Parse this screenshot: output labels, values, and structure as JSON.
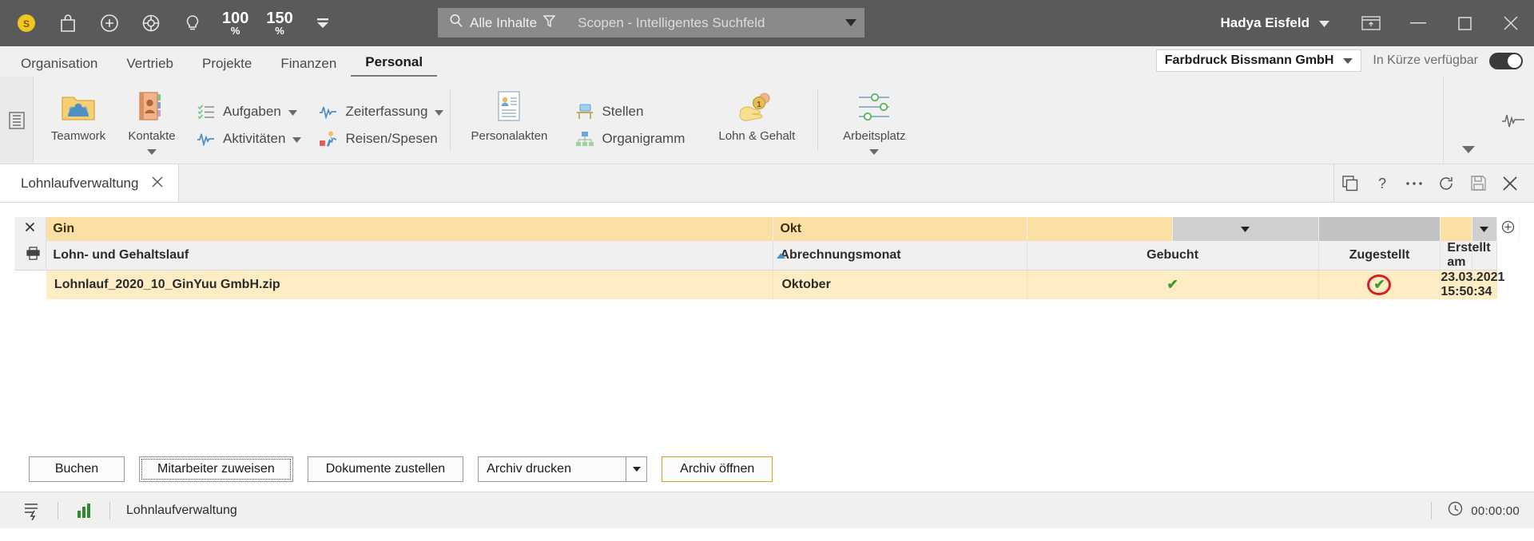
{
  "titlebar": {
    "quick_access": [
      {
        "name": "app-logo-icon",
        "label": "Scopevisio"
      },
      {
        "name": "shopping-bag-icon",
        "label": "Shop"
      },
      {
        "name": "plus-circle-icon",
        "label": "Neu"
      },
      {
        "name": "lifebuoy-icon",
        "label": "Hilfe"
      },
      {
        "name": "lightbulb-icon",
        "label": "Ideen"
      }
    ],
    "zoom_100": "100",
    "zoom_100_pct": "%",
    "zoom_150": "150",
    "zoom_150_pct": "%",
    "overflow_caret": "▼",
    "search_scope": "Alle Inhalte",
    "search_placeholder": "Scopen - Intelligentes Suchfeld",
    "search_value": "",
    "user": "Hadya Eisfeld",
    "window_buttons": {
      "restore_down": "🗗",
      "minimize": "—",
      "maximize": "□",
      "close": "✕"
    }
  },
  "ribbon": {
    "tabs": [
      {
        "label": "Organisation",
        "active": false
      },
      {
        "label": "Vertrieb",
        "active": false
      },
      {
        "label": "Projekte",
        "active": false
      },
      {
        "label": "Finanzen",
        "active": false
      },
      {
        "label": "Personal",
        "active": true
      }
    ],
    "company": "Farbdruck Bissmann GmbH",
    "availability_label": "In Kürze verfügbar",
    "availability_on": true,
    "big_buttons": [
      {
        "label": "Teamwork",
        "icon": "teamwork-folder-icon",
        "has_caret": false
      },
      {
        "label": "Kontakte",
        "icon": "contacts-book-icon",
        "has_caret": true
      },
      {
        "label": "Personalakten",
        "icon": "personnel-file-icon",
        "has_caret": false
      },
      {
        "label": "Lohn & Gehalt",
        "icon": "payroll-hand-coin-icon",
        "has_caret": false
      },
      {
        "label": "Arbeitsplatz",
        "icon": "workplace-sliders-icon",
        "has_caret": true
      }
    ],
    "small_buttons": [
      {
        "label": "Aufgaben",
        "icon": "tasks-checklist-icon",
        "has_caret": true
      },
      {
        "label": "Aktivitäten",
        "icon": "activities-pulse-icon",
        "has_caret": true
      },
      {
        "label": "Zeiterfassung",
        "icon": "time-tracking-pulse-icon",
        "has_caret": true
      },
      {
        "label": "Reisen/Spesen",
        "icon": "travel-expenses-icon",
        "has_caret": false
      },
      {
        "label": "Stellen",
        "icon": "jobs-desk-icon",
        "has_caret": false
      },
      {
        "label": "Organigramm",
        "icon": "org-chart-icon",
        "has_caret": false
      }
    ]
  },
  "doctabs": {
    "active_tab": "Lohnlaufverwaltung",
    "close_glyph": "✕",
    "tools": [
      {
        "name": "duplicate-window-icon"
      },
      {
        "name": "help-question-icon"
      },
      {
        "name": "more-options-icon"
      },
      {
        "name": "refresh-icon"
      },
      {
        "name": "save-icon"
      },
      {
        "name": "close-icon"
      }
    ]
  },
  "grid": {
    "filter_row": {
      "clear_glyph": "✕",
      "name_filter": "Gin",
      "month_filter": "Okt",
      "gebucht_filter": "",
      "zugestellt_filter": "",
      "erstellt_filter": "",
      "dropdown_glyph": "▼",
      "add_column_glyph": "⊕"
    },
    "columns": [
      {
        "key": "name",
        "label": "Lohn- und Gehaltslauf",
        "sorted": true,
        "sort_dir": "▲",
        "align": "left"
      },
      {
        "key": "month",
        "label": "Abrechnungsmonat",
        "sorted": false,
        "align": "left"
      },
      {
        "key": "gebucht",
        "label": "Gebucht",
        "sorted": false,
        "align": "center"
      },
      {
        "key": "zugestellt",
        "label": "Zugestellt",
        "sorted": false,
        "align": "center"
      },
      {
        "key": "erstellt",
        "label": "Erstellt am",
        "sorted": false,
        "align": "left"
      }
    ],
    "rows": [
      {
        "name": "Lohnlauf_2020_10_GinYuu GmbH.zip",
        "month": "Oktober",
        "gebucht": "✔",
        "zugestellt": "✔",
        "zugestellt_highlighted": true,
        "erstellt": "23.03.2021 15:50:34"
      }
    ],
    "print_gutter_icon": "printer-icon"
  },
  "actions": {
    "buchen": "Buchen",
    "mitarbeiter_zuweisen": "Mitarbeiter zuweisen",
    "dokumente_zustellen": "Dokumente zustellen",
    "archiv_drucken": "Archiv drucken",
    "archiv_drucken_arrow": "▼",
    "archiv_oeffnen": "Archiv öffnen"
  },
  "statusbar": {
    "workflow_icon": "workflow-icon",
    "chart_icon": "bar-chart-icon",
    "module": "Lohnlaufverwaltung",
    "timer_icon": "clock-icon",
    "timer": "00:00:00"
  },
  "colors": {
    "titlebar_bg": "#5a5a5a",
    "accent_yellow": "#fbdfa4",
    "row_yellow": "#fdecc4",
    "check_green": "#3a9e2f",
    "highlight_red": "#d81f26",
    "ribbon_bg": "#f0f0f0"
  }
}
